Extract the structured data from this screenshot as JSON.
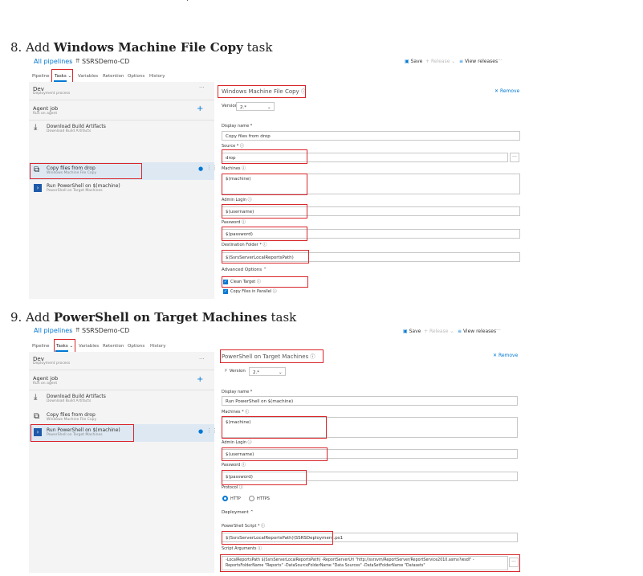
{
  "top_dot": "·",
  "steps": [
    {
      "num": "8.",
      "pre": "Add",
      "bold": "Windows Machine File Copy",
      "post": "task"
    },
    {
      "num": "9.",
      "pre": "Add",
      "bold": "PowerShell on Target Machines",
      "post": "task"
    }
  ],
  "common": {
    "all_pipelines": "All pipelines",
    "breadcrumb_sep": "›",
    "pipeline_name": "SSRSDemo-CD",
    "save": "Save",
    "release": "Release",
    "view_releases": "View releases",
    "more": "···",
    "tabs": [
      "Pipeline",
      "Tasks",
      "Variables",
      "Retention",
      "Options",
      "History"
    ],
    "stage_name": "Dev",
    "stage_sub": "Deployment process",
    "agent_job": "Agent job",
    "agent_sub": "Run on agent",
    "add": "+",
    "remove": "Remove",
    "task_download": "Download Build Artifacts",
    "task_download_sub": "Download Build Artifacts",
    "task_copy": "Copy files from drop",
    "task_copy_sub": "Windows Machine File Copy",
    "task_ps": "Run PowerShell on $(machine)",
    "task_ps_sub": "PowerShell on Target Machines",
    "version_label": "Version",
    "version_value": "2.*"
  },
  "panel1": {
    "task_title": "Windows Machine File Copy",
    "display_name_label": "Display name *",
    "display_name_value": "Copy files from drop",
    "source_label": "Source *",
    "source_value": "drop",
    "machines_label": "Machines",
    "machines_value": "$(machine)",
    "admin_login_label": "Admin Login",
    "admin_login_value": "$(username)",
    "password_label": "Password",
    "password_value": "$(password)",
    "dest_label": "Destination Folder *",
    "dest_value": "$(SsrsServerLocalReportsPath)",
    "advanced_label": "Advanced Options",
    "clean_target": "Clean Target",
    "copy_parallel": "Copy Files in Parallel"
  },
  "panel2": {
    "task_title": "PowerShell on Target Machines",
    "display_name_label": "Display name *",
    "display_name_value": "Run PowerShell on $(machine)",
    "machines_label": "Machines *",
    "machines_value": "$(machine)",
    "admin_login_label": "Admin Login",
    "admin_login_value": "$(username)",
    "password_label": "Password",
    "password_value": "$(password)",
    "protocol_label": "Protocol",
    "http": "HTTP",
    "https": "HTTPS",
    "deployment_label": "Deployment",
    "ps_script_label": "PowerShell Script *",
    "ps_script_value": "$(SsrsServerLocalReportsPath)\\SSRSDeployment.ps1",
    "script_args_label": "Script Arguments",
    "script_args_line1": "-LocalReportsPath $(SsrsServerLocalReportsPath) -ReportServerUri \"http://ssrsvm/ReportServer/ReportService2010.asmx?wsdl\" -",
    "script_args_line2": "ReportsFolderName \"Reports\" -DataSourceFolderName \"Data Sources\" -DataSetFolderName \"Datasets\""
  },
  "colors": {
    "accent": "#0078d4",
    "highlight_border": "#d9262b",
    "selected_row": "#dde8f3"
  }
}
